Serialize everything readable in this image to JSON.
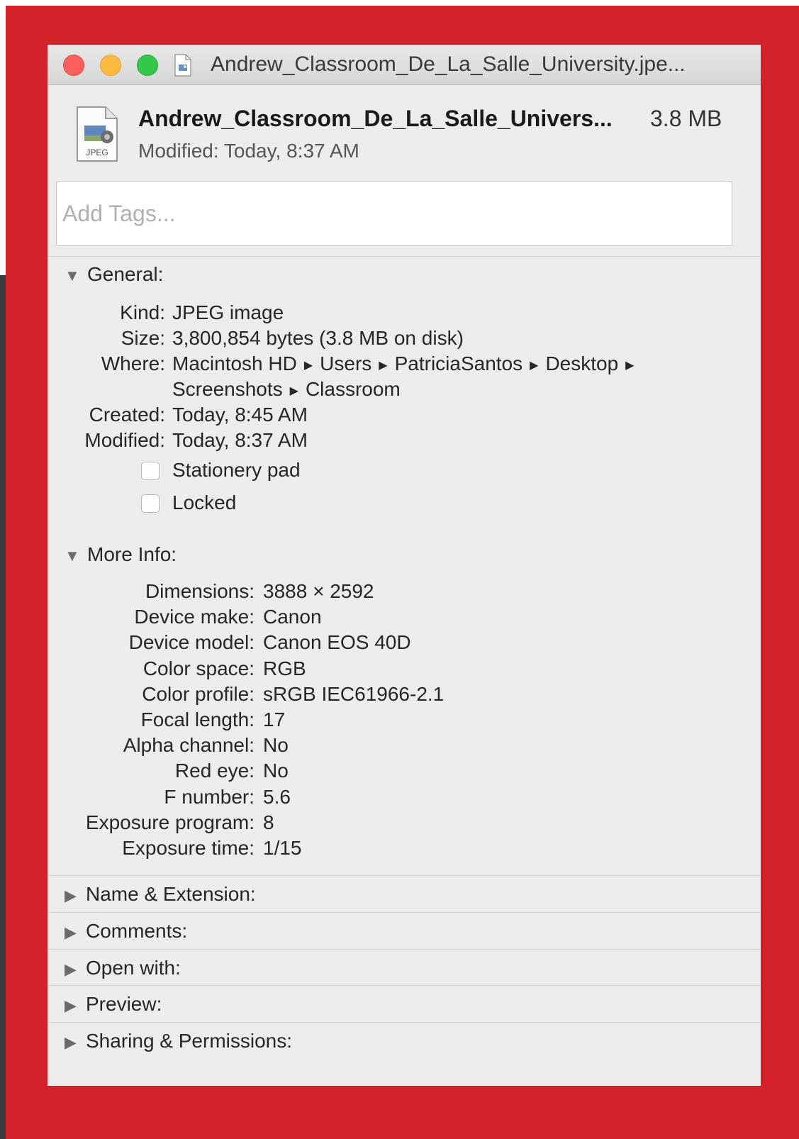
{
  "window": {
    "title": "Andrew_Classroom_De_La_Salle_University.jpe..."
  },
  "header": {
    "icon_label": "JPEG",
    "file_name": "Andrew_Classroom_De_La_Salle_Univers...",
    "file_size": "3.8 MB",
    "modified_label": "Modified:",
    "modified_value": "Today, 8:37 AM"
  },
  "tags": {
    "placeholder": "Add Tags..."
  },
  "general": {
    "title": "General:",
    "rows": [
      {
        "label": "Kind:",
        "value": "JPEG image"
      },
      {
        "label": "Size:",
        "value": "3,800,854 bytes (3.8 MB on disk)"
      },
      {
        "label": "Where:",
        "path": [
          "Macintosh HD",
          "Users",
          "PatriciaSantos",
          "Desktop",
          "Screenshots",
          "Classroom"
        ]
      },
      {
        "label": "Created:",
        "value": "Today, 8:45 AM"
      },
      {
        "label": "Modified:",
        "value": "Today, 8:37 AM"
      }
    ],
    "stationery_pad": "Stationery pad",
    "locked": "Locked"
  },
  "more_info": {
    "title": "More Info:",
    "rows": [
      {
        "label": "Dimensions:",
        "value": "3888 × 2592"
      },
      {
        "label": "Device make:",
        "value": "Canon"
      },
      {
        "label": "Device model:",
        "value": "Canon EOS 40D"
      },
      {
        "label": "Color space:",
        "value": "RGB"
      },
      {
        "label": "Color profile:",
        "value": "sRGB IEC61966-2.1"
      },
      {
        "label": "Focal length:",
        "value": "17"
      },
      {
        "label": "Alpha channel:",
        "value": "No"
      },
      {
        "label": "Red eye:",
        "value": "No"
      },
      {
        "label": "F number:",
        "value": "5.6"
      },
      {
        "label": "Exposure program:",
        "value": "8"
      },
      {
        "label": "Exposure time:",
        "value": "1/15"
      }
    ]
  },
  "collapsed_sections": [
    "Name & Extension:",
    "Comments:",
    "Open with:",
    "Preview:",
    "Sharing & Permissions:"
  ],
  "icons": {
    "expanded": "disclosure-down-icon",
    "collapsed": "disclosure-right-icon",
    "path_separator": "path-arrow-icon"
  },
  "colors": {
    "highlight_frame": "#d3212a",
    "close": "#fc605c",
    "minimize": "#fdbc40",
    "zoom": "#34c84a"
  }
}
